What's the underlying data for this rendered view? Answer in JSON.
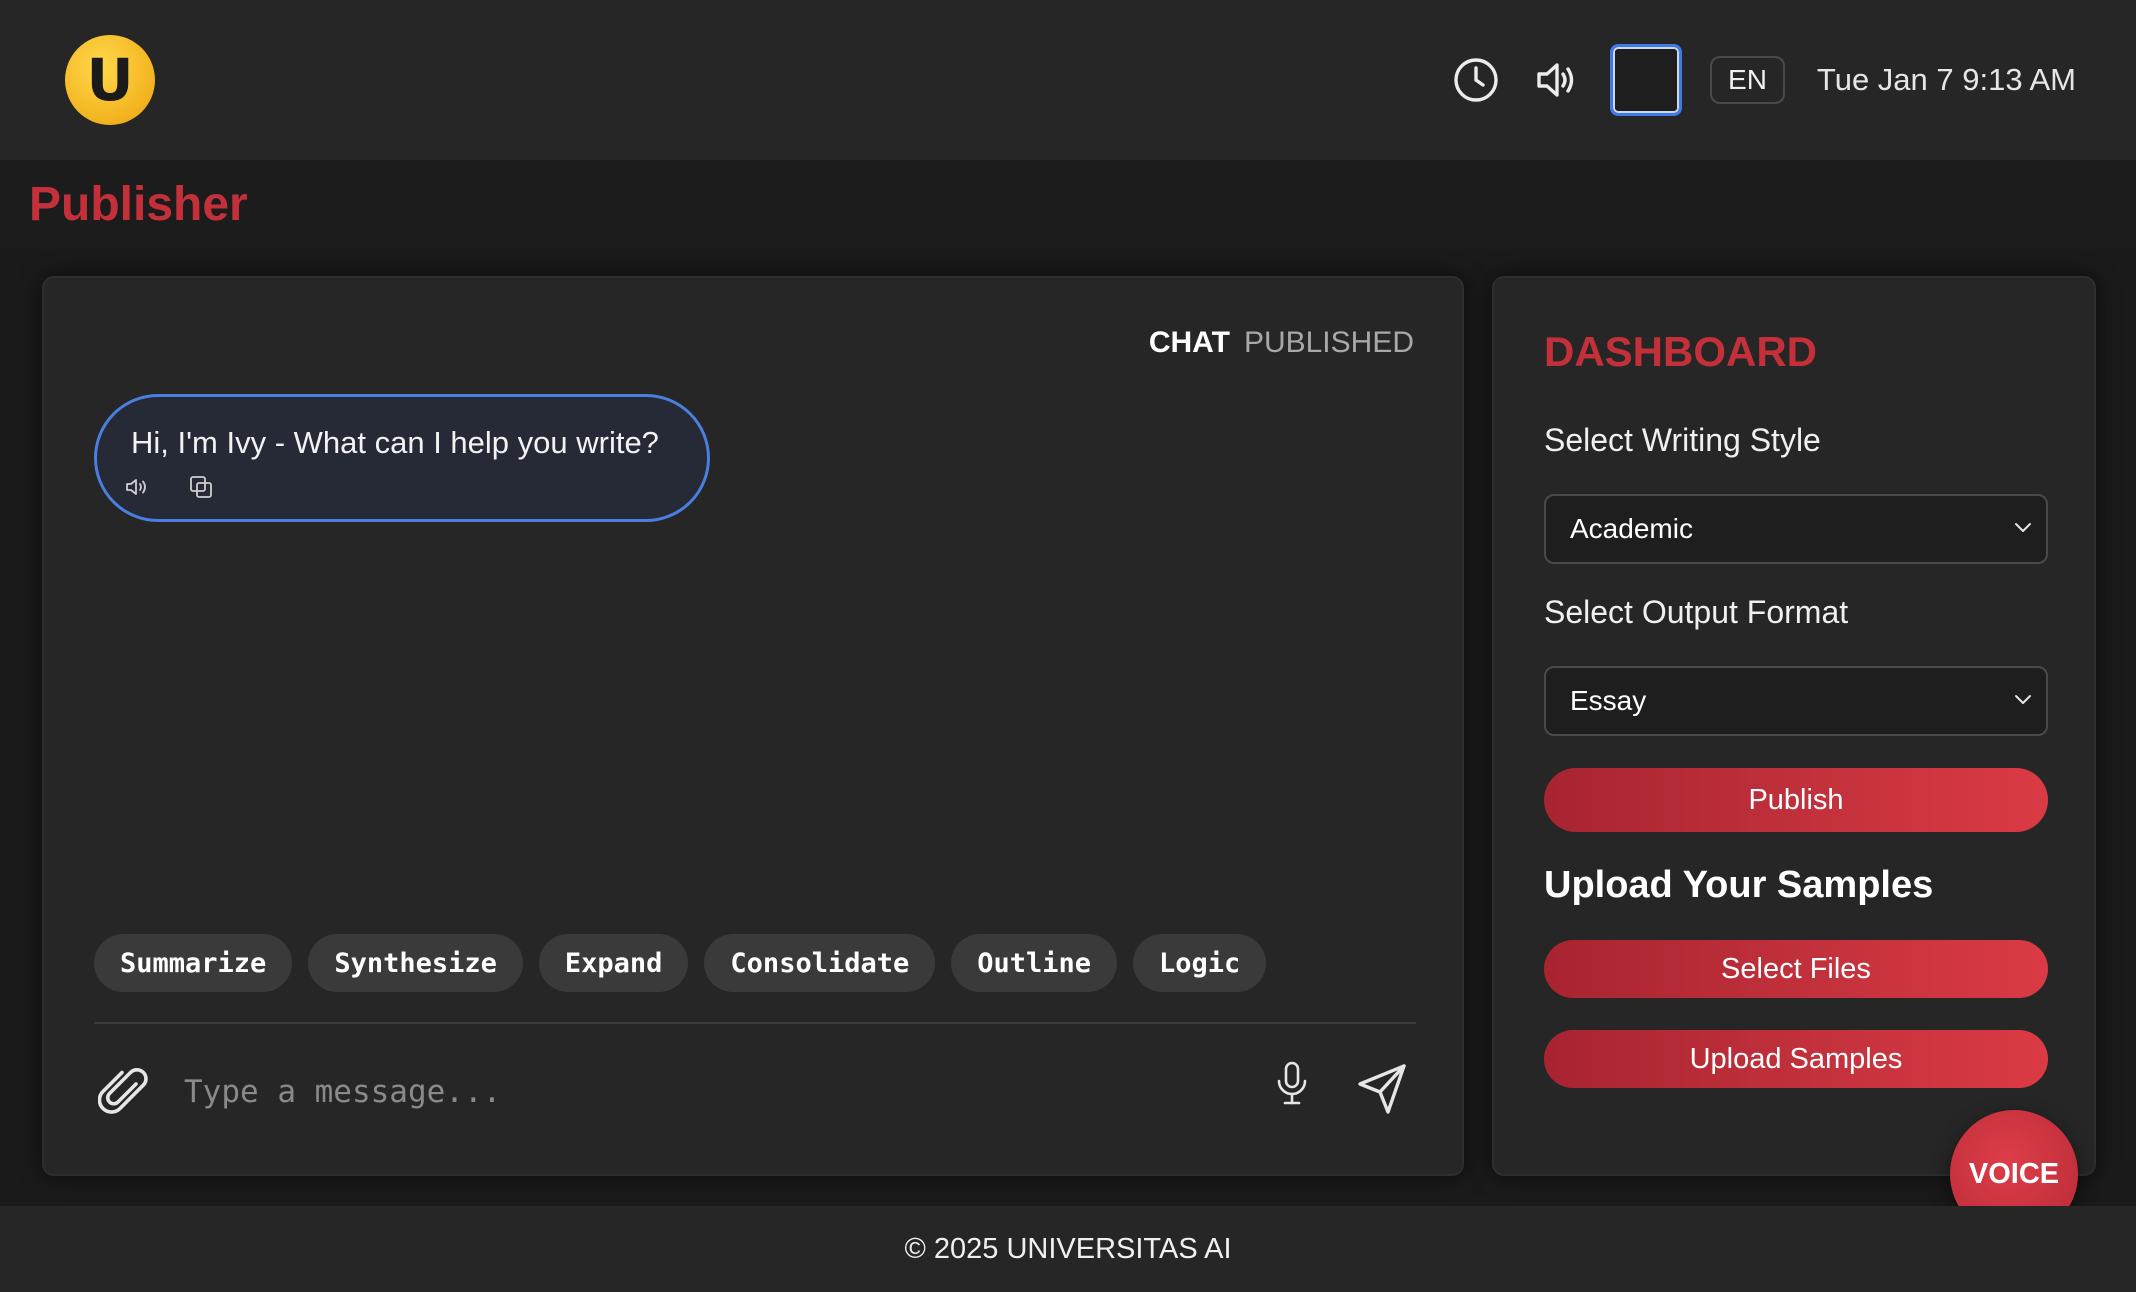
{
  "header": {
    "logo_letter": "U",
    "language": "EN",
    "datetime": "Tue Jan 7 9:13 AM",
    "swatch_color": "#1e1e1e",
    "icons": [
      "clock-icon",
      "speaker-icon"
    ]
  },
  "page": {
    "title": "Publisher"
  },
  "chat": {
    "tabs": [
      {
        "label": "CHAT",
        "active": true
      },
      {
        "label": "PUBLISHED",
        "active": false
      }
    ],
    "messages": [
      {
        "sender": "assistant",
        "text": "Hi, I'm Ivy - What can I help you write?"
      }
    ],
    "quick_actions": [
      "Summarize",
      "Synthesize",
      "Expand",
      "Consolidate",
      "Outline",
      "Logic"
    ],
    "input": {
      "value": "",
      "placeholder": "Type a message..."
    }
  },
  "dashboard": {
    "title": "DASHBOARD",
    "writing_style": {
      "label": "Select Writing Style",
      "selected": "Academic"
    },
    "output_format": {
      "label": "Select Output Format",
      "selected": "Essay"
    },
    "publish_label": "Publish",
    "upload": {
      "heading": "Upload Your Samples",
      "select_files_label": "Select Files",
      "upload_label": "Upload Samples"
    }
  },
  "voice_button": "VOICE",
  "footer": {
    "text": "© 2025 UNIVERSITAS AI"
  },
  "colors": {
    "accent_red": "#c3303a",
    "bubble_border": "#4a7fe0",
    "logo_yellow": "#f3b31f",
    "background": "#1a1a1a",
    "panel": "#262626"
  }
}
